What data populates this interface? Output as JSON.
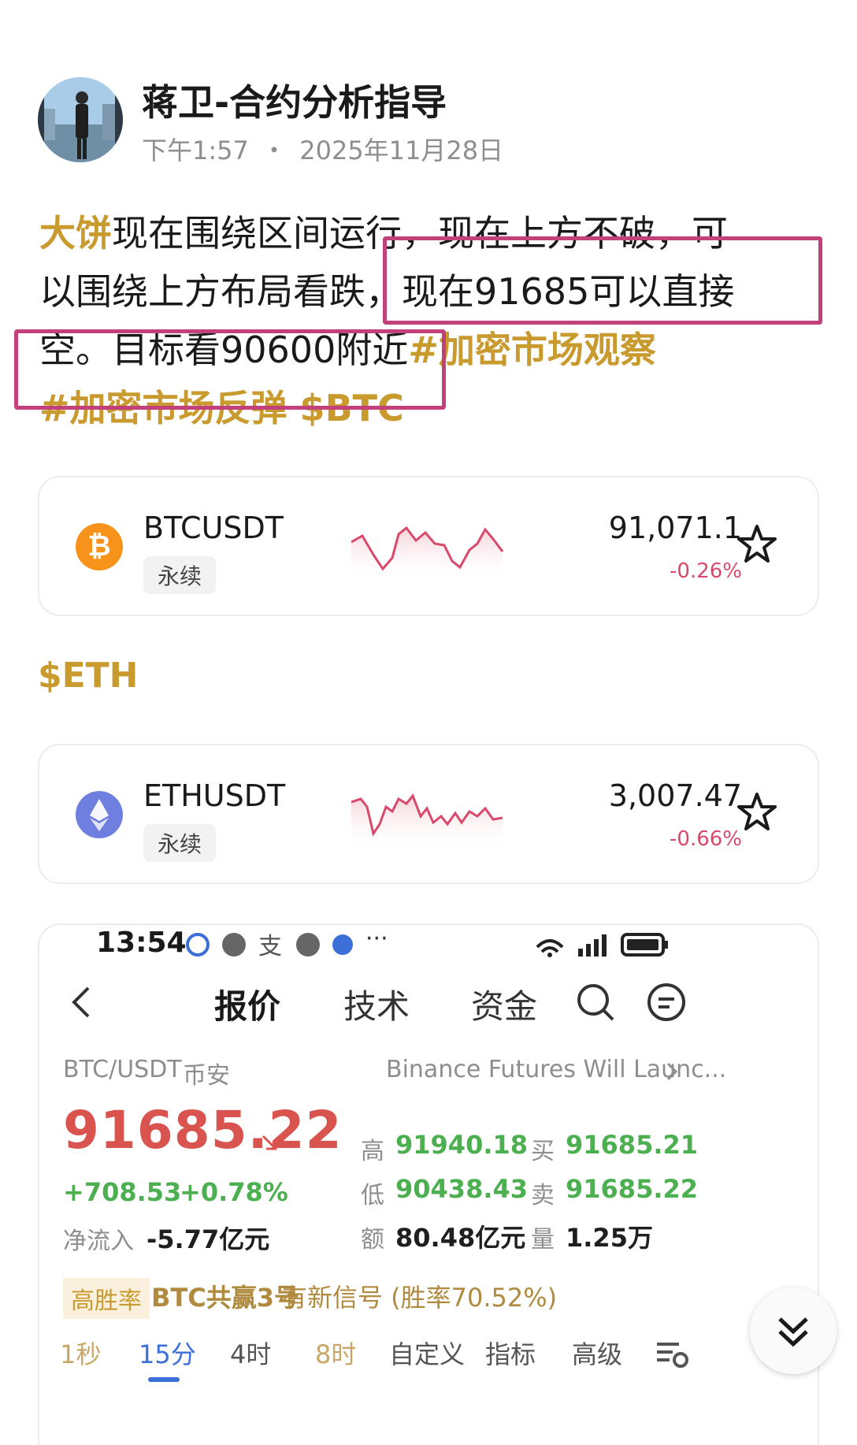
{
  "post": {
    "author": "蒋卫-合约分析指导",
    "time": "下午1:57",
    "date_sep": "・",
    "date": "2025年11月28日",
    "line1_gold": "大饼",
    "line1_rest": "现在围绕区间运行，现在上方不破，可",
    "line2": "以围绕上方布局看跌，现在91685可以直接",
    "line3": "空。目标看90600附近",
    "line3_tag": "#加密市场观察",
    "line4_tags": "#加密市场反弹 $BTC",
    "eth_tag": "$ETH"
  },
  "tickers": [
    {
      "symbol": "BTCUSDT",
      "badge": "永续",
      "price": "91,071.1",
      "change": "-0.26%",
      "icon": "bitcoin-icon",
      "icon_glyph": "₿",
      "color": "#f7931a"
    },
    {
      "symbol": "ETHUSDT",
      "badge": "永续",
      "price": "3,007.47",
      "change": "-0.66%",
      "icon": "ethereum-icon",
      "color": "#6f7fe0"
    }
  ],
  "screenshot": {
    "status_time": "13:54",
    "status_apps": "支",
    "status_more": "···",
    "nav": {
      "back": "back-icon",
      "tab1": "报价",
      "tab2": "技术",
      "tab3": "资金",
      "search": "search-icon",
      "menu": "menu-icon"
    },
    "pair": "BTC/USDT",
    "exchange": "币安",
    "news": "Binance Futures Will Launc...",
    "price": "91685.22",
    "change_abs": "+708.53",
    "change_pct": "+0.78%",
    "net_inflow_label": "净流入",
    "net_inflow_value": "-5.77亿元",
    "stats": [
      {
        "label": "高",
        "value": "91940.18"
      },
      {
        "label": "买",
        "value": "91685.21"
      },
      {
        "label": "低",
        "value": "90438.43"
      },
      {
        "label": "卖",
        "value": "91685.22"
      },
      {
        "label": "额",
        "value": "80.48亿元"
      },
      {
        "label": "量",
        "value": "1.25万"
      }
    ],
    "signal_badge": "高胜率",
    "signal_name": "BTC共赢3号",
    "signal_text": "有新信号 (胜率70.52%)",
    "timeframes": [
      "1秒",
      "15分",
      "4时",
      "8时",
      "自定义",
      "指标",
      "高级"
    ]
  }
}
